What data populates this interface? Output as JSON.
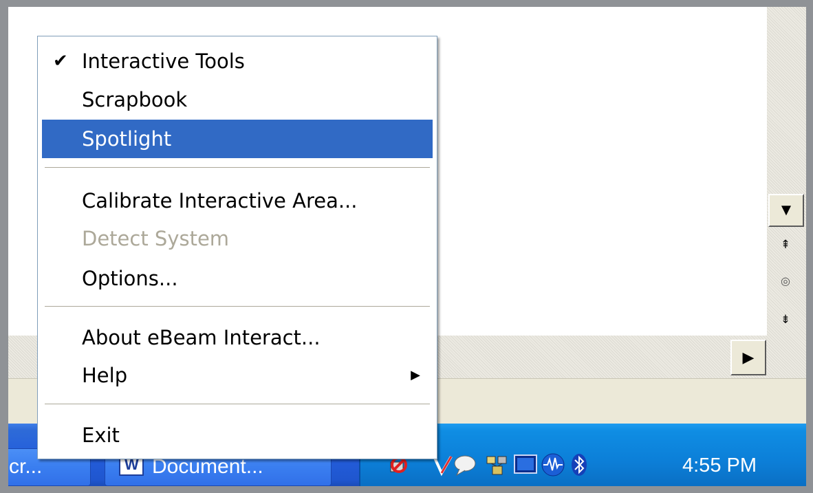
{
  "menu": {
    "items": [
      {
        "label": "Interactive Tools",
        "checked": true
      },
      {
        "label": "Scrapbook"
      },
      {
        "label": "Spotlight",
        "highlighted": true
      },
      {
        "label": "Calibrate Interactive Area..."
      },
      {
        "label": "Detect System",
        "disabled": true
      },
      {
        "label": "Options..."
      },
      {
        "label": "About eBeam Interact..."
      },
      {
        "label": "Help",
        "has_submenu": true
      },
      {
        "label": "Exit"
      }
    ]
  },
  "taskbar": {
    "buttons": [
      {
        "label": "cr..."
      },
      {
        "label": "Document..."
      }
    ],
    "tray_icons": [
      "network-disconnected-icon",
      "ebeam-icon",
      "messenger-icon",
      "network-icon",
      "monitor-icon",
      "audio-wave-icon",
      "bluetooth-icon"
    ],
    "clock": "4:55 PM"
  },
  "colors": {
    "menu_highlight": "#316ac5",
    "taskbar_blue": "#245edc",
    "tray_blue": "#0c7fd8",
    "disabled_text": "#aca899"
  }
}
